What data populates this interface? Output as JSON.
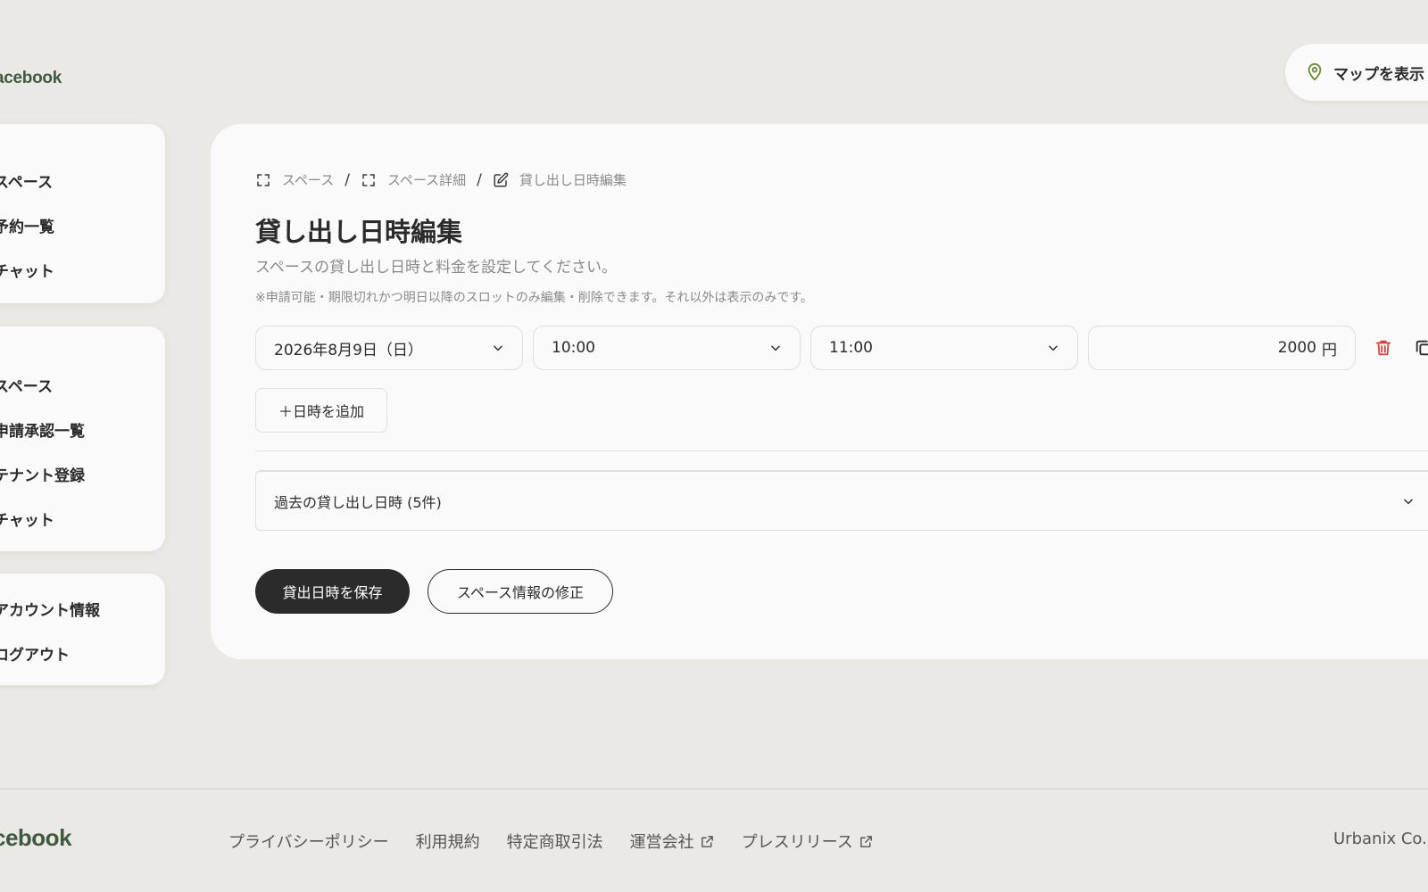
{
  "header": {
    "logo_text": "acebook",
    "map_button_label": "マップを表示"
  },
  "sidebar": {
    "group1": [
      "スペース",
      "予約一覧",
      "チャット"
    ],
    "group2": [
      "スペース",
      "申請承認一覧",
      "テナント登録",
      "チャット"
    ],
    "group3": [
      "アカウント情報",
      "ログアウト"
    ]
  },
  "breadcrumb": [
    "スペース",
    "スペース詳細",
    "貸し出し日時編集"
  ],
  "main": {
    "title": "貸し出し日時編集",
    "subtitle": "スペースの貸し出し日時と料金を設定してください。",
    "note": "※申請可能・期限切れかつ明日以降のスロットのみ編集・削除できます。それ以外は表示のみです。",
    "slot": {
      "date": "2026年8月9日（日）",
      "start_time": "10:00",
      "end_time": "11:00",
      "price": "2000",
      "currency": "円"
    },
    "add_button_label": "＋日時を追加",
    "past_slots_label": "過去の貸し出し日時 (5件)",
    "save_button_label": "貸出日時を保存",
    "edit_space_button_label": "スペース情報の修正"
  },
  "footer": {
    "logo_text": "cebook",
    "links": [
      "プライバシーポリシー",
      "利用規約",
      "特定商取引法",
      "運営会社",
      "プレスリリース"
    ],
    "copyright": "Urbanix Co."
  },
  "colors": {
    "background": "#ebe9e5",
    "card": "#fafafa",
    "brand_green": "#3f5a3f",
    "delete_red": "#d64541",
    "primary_dark": "#2b2b2b"
  }
}
